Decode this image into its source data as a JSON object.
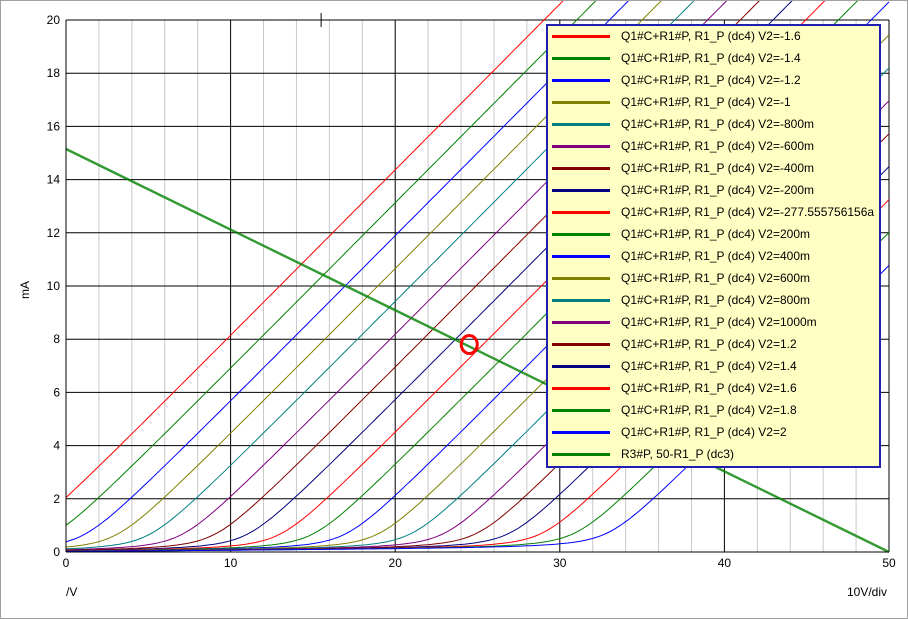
{
  "chart_data": {
    "type": "line",
    "ylabel": "mA",
    "xlabel_left": "/V",
    "xlabel_right": "10V/div",
    "xlim": [
      0,
      50
    ],
    "ylim": [
      0,
      20
    ],
    "x_ticks": [
      0,
      10,
      20,
      30,
      40,
      50
    ],
    "y_ticks": [
      0,
      2,
      4,
      6,
      8,
      10,
      12,
      14,
      16,
      18,
      20
    ],
    "grid": true,
    "legend_position": "top-right",
    "cursor_marker": {
      "x": 15.5,
      "y": 20
    },
    "operating_point": {
      "x": 24.5,
      "y": 7.8
    },
    "series": [
      {
        "name": "Q1#C+R1#P, R1_P (dc4) V2=-1.6",
        "color": "#ff0000",
        "knee_x": -3.0
      },
      {
        "name": "Q1#C+R1#P, R1_P (dc4) V2=-1.4",
        "color": "#008000",
        "knee_x": -1.0
      },
      {
        "name": "Q1#C+R1#P, R1_P (dc4) V2=-1.2",
        "color": "#0000ff",
        "knee_x": 1.0
      },
      {
        "name": "Q1#C+R1#P, R1_P (dc4) V2=-1",
        "color": "#808000",
        "knee_x": 3.0
      },
      {
        "name": "Q1#C+R1#P, R1_P (dc4) V2=-800m",
        "color": "#008080",
        "knee_x": 5.0
      },
      {
        "name": "Q1#C+R1#P, R1_P (dc4) V2=-600m",
        "color": "#800080",
        "knee_x": 7.0
      },
      {
        "name": "Q1#C+R1#P, R1_P (dc4) V2=-400m",
        "color": "#800000",
        "knee_x": 9.0
      },
      {
        "name": "Q1#C+R1#P, R1_P (dc4) V2=-200m",
        "color": "#000080",
        "knee_x": 11.0
      },
      {
        "name": "Q1#C+R1#P, R1_P (dc4) V2=-277.555756156a",
        "color": "#ff0000",
        "knee_x": 13.0
      },
      {
        "name": "Q1#C+R1#P, R1_P (dc4) V2=200m",
        "color": "#008000",
        "knee_x": 15.0
      },
      {
        "name": "Q1#C+R1#P, R1_P (dc4) V2=400m",
        "color": "#0000ff",
        "knee_x": 17.0
      },
      {
        "name": "Q1#C+R1#P, R1_P (dc4) V2=600m",
        "color": "#808000",
        "knee_x": 19.0
      },
      {
        "name": "Q1#C+R1#P, R1_P (dc4) V2=800m",
        "color": "#008080",
        "knee_x": 21.0
      },
      {
        "name": "Q1#C+R1#P, R1_P (dc4) V2=1000m",
        "color": "#800080",
        "knee_x": 23.0
      },
      {
        "name": "Q1#C+R1#P, R1_P (dc4) V2=1.2",
        "color": "#800000",
        "knee_x": 25.0
      },
      {
        "name": "Q1#C+R1#P, R1_P (dc4) V2=1.4",
        "color": "#000080",
        "knee_x": 27.0
      },
      {
        "name": "Q1#C+R1#P, R1_P (dc4) V2=1.6",
        "color": "#ff0000",
        "knee_x": 29.0
      },
      {
        "name": "Q1#C+R1#P, R1_P (dc4) V2=1.8",
        "color": "#008000",
        "knee_x": 31.0
      },
      {
        "name": "Q1#C+R1#P, R1_P (dc4) V2=2",
        "color": "#0000ff",
        "knee_x": 33.0
      },
      {
        "name": "R3#P, 50-R1_P (dc3)",
        "color": "#008000",
        "x": [
          0,
          50
        ],
        "y": [
          15.15,
          0
        ]
      }
    ]
  }
}
